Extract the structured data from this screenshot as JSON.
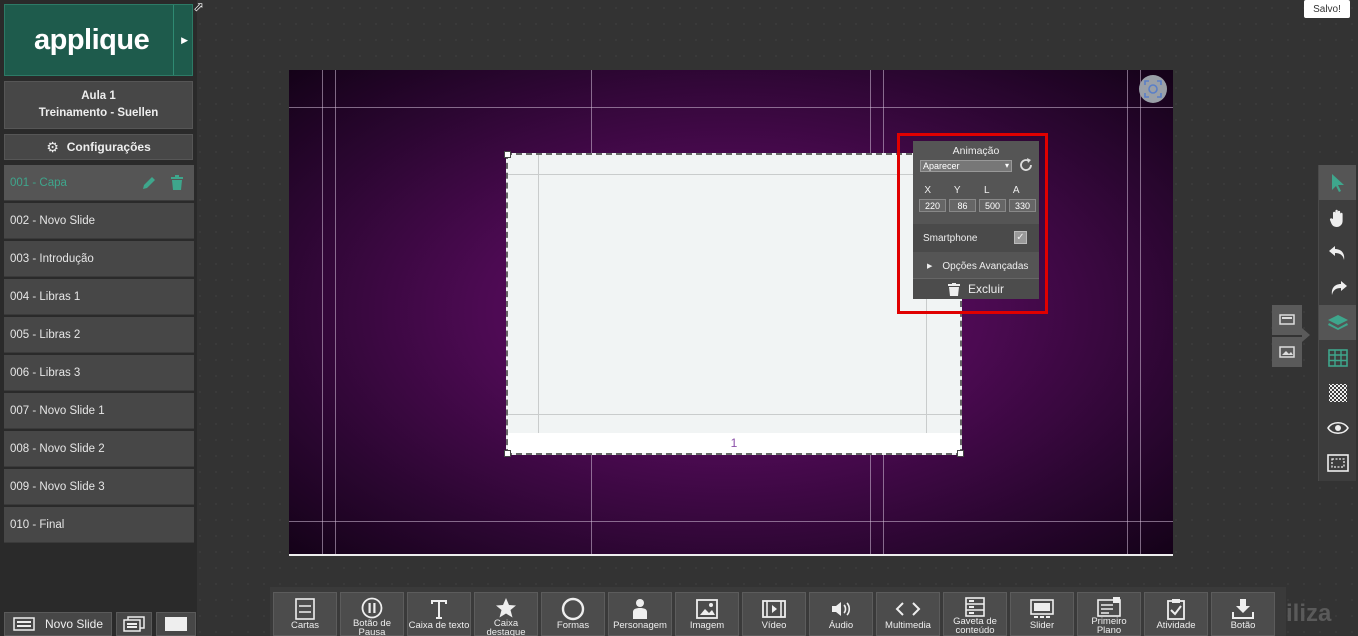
{
  "app": {
    "brand": "applique",
    "toast": "Salvo!"
  },
  "lesson": {
    "title": "Aula 1",
    "subtitle": "Treinamento - Suellen"
  },
  "config": {
    "label": "Configurações"
  },
  "slides": [
    {
      "label": "001 - Capa"
    },
    {
      "label": "002 - Novo Slide"
    },
    {
      "label": "003 - Introdução"
    },
    {
      "label": "004 - Libras 1"
    },
    {
      "label": "005 - Libras 2"
    },
    {
      "label": "006 - Libras 3"
    },
    {
      "label": "007 - Novo Slide 1"
    },
    {
      "label": "008 - Novo Slide 2"
    },
    {
      "label": "009 - Novo Slide 3"
    },
    {
      "label": "010 - Final"
    }
  ],
  "bottom_left": {
    "new_slide": "Novo Slide"
  },
  "canvas": {
    "page_number": "1"
  },
  "animation_panel": {
    "title": "Animação",
    "selected": "Aparecer",
    "labels": {
      "x": "X",
      "y": "Y",
      "l": "L",
      "a": "A"
    },
    "values": {
      "x": "220",
      "y": "86",
      "l": "500",
      "a": "330"
    },
    "smartphone": "Smartphone",
    "advanced": "Opções Avançadas",
    "delete": "Excluir"
  },
  "toolbar": [
    {
      "label": "Cartas"
    },
    {
      "label": "Botão de Pausa"
    },
    {
      "label": "Caixa de texto"
    },
    {
      "label": "Caixa destaque"
    },
    {
      "label": "Formas"
    },
    {
      "label": "Personagem"
    },
    {
      "label": "Imagem"
    },
    {
      "label": "Vídeo"
    },
    {
      "label": "Áudio"
    },
    {
      "label": "Multimedia"
    },
    {
      "label": "Gaveta de conteúdo"
    },
    {
      "label": "Slider"
    },
    {
      "label": "Primeiro Plano"
    },
    {
      "label": "Atividade"
    },
    {
      "label": "Botão"
    }
  ],
  "watermark": "iliza",
  "colors": {
    "accent": "#3ea68c",
    "brand": "#1e5b4c",
    "highlight": "#e00000"
  }
}
